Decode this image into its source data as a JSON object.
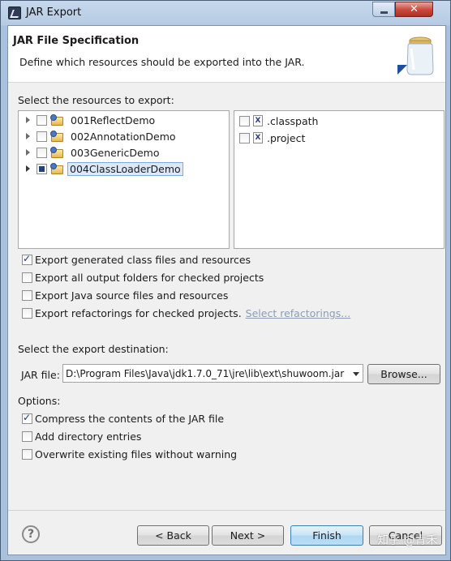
{
  "window": {
    "title": "JAR Export",
    "close_glyph": "✕"
  },
  "header": {
    "title": "JAR File Specification",
    "description": "Define which resources should be exported into the JAR."
  },
  "resources": {
    "label": "Select the resources to export:",
    "projects": [
      {
        "name": "001ReflectDemo",
        "checked": false
      },
      {
        "name": "002AnnotationDemo",
        "checked": false
      },
      {
        "name": "003GenericDemo",
        "checked": false
      },
      {
        "name": "004ClassLoaderDemo",
        "checked": "partial",
        "selected": true
      }
    ],
    "files": [
      {
        "name": ".classpath",
        "checked": false
      },
      {
        "name": ".project",
        "checked": false
      }
    ]
  },
  "export_options": [
    {
      "label": "Export generated class files and resources",
      "checked": true
    },
    {
      "label": "Export all output folders for checked projects",
      "checked": false
    },
    {
      "label": "Export Java source files and resources",
      "checked": false
    },
    {
      "label": "Export refactorings for checked projects.",
      "checked": false,
      "link": "Select refactorings..."
    }
  ],
  "destination": {
    "label": "Select the export destination:",
    "jar_file_label": "JAR file:",
    "jar_file_value": "D:\\Program Files\\Java\\jdk1.7.0_71\\jre\\lib\\ext\\shuwoom.jar",
    "browse_label": "Browse..."
  },
  "options": {
    "label": "Options:",
    "items": [
      {
        "label": "Compress the contents of the JAR file",
        "checked": true
      },
      {
        "label": "Add directory entries",
        "checked": false
      },
      {
        "label": "Overwrite existing files without warning",
        "checked": false
      }
    ]
  },
  "buttons": {
    "help": "?",
    "back": "< Back",
    "next": "Next >",
    "finish": "Finish",
    "cancel": "Cancel"
  },
  "watermark": "知乎 @青禾"
}
